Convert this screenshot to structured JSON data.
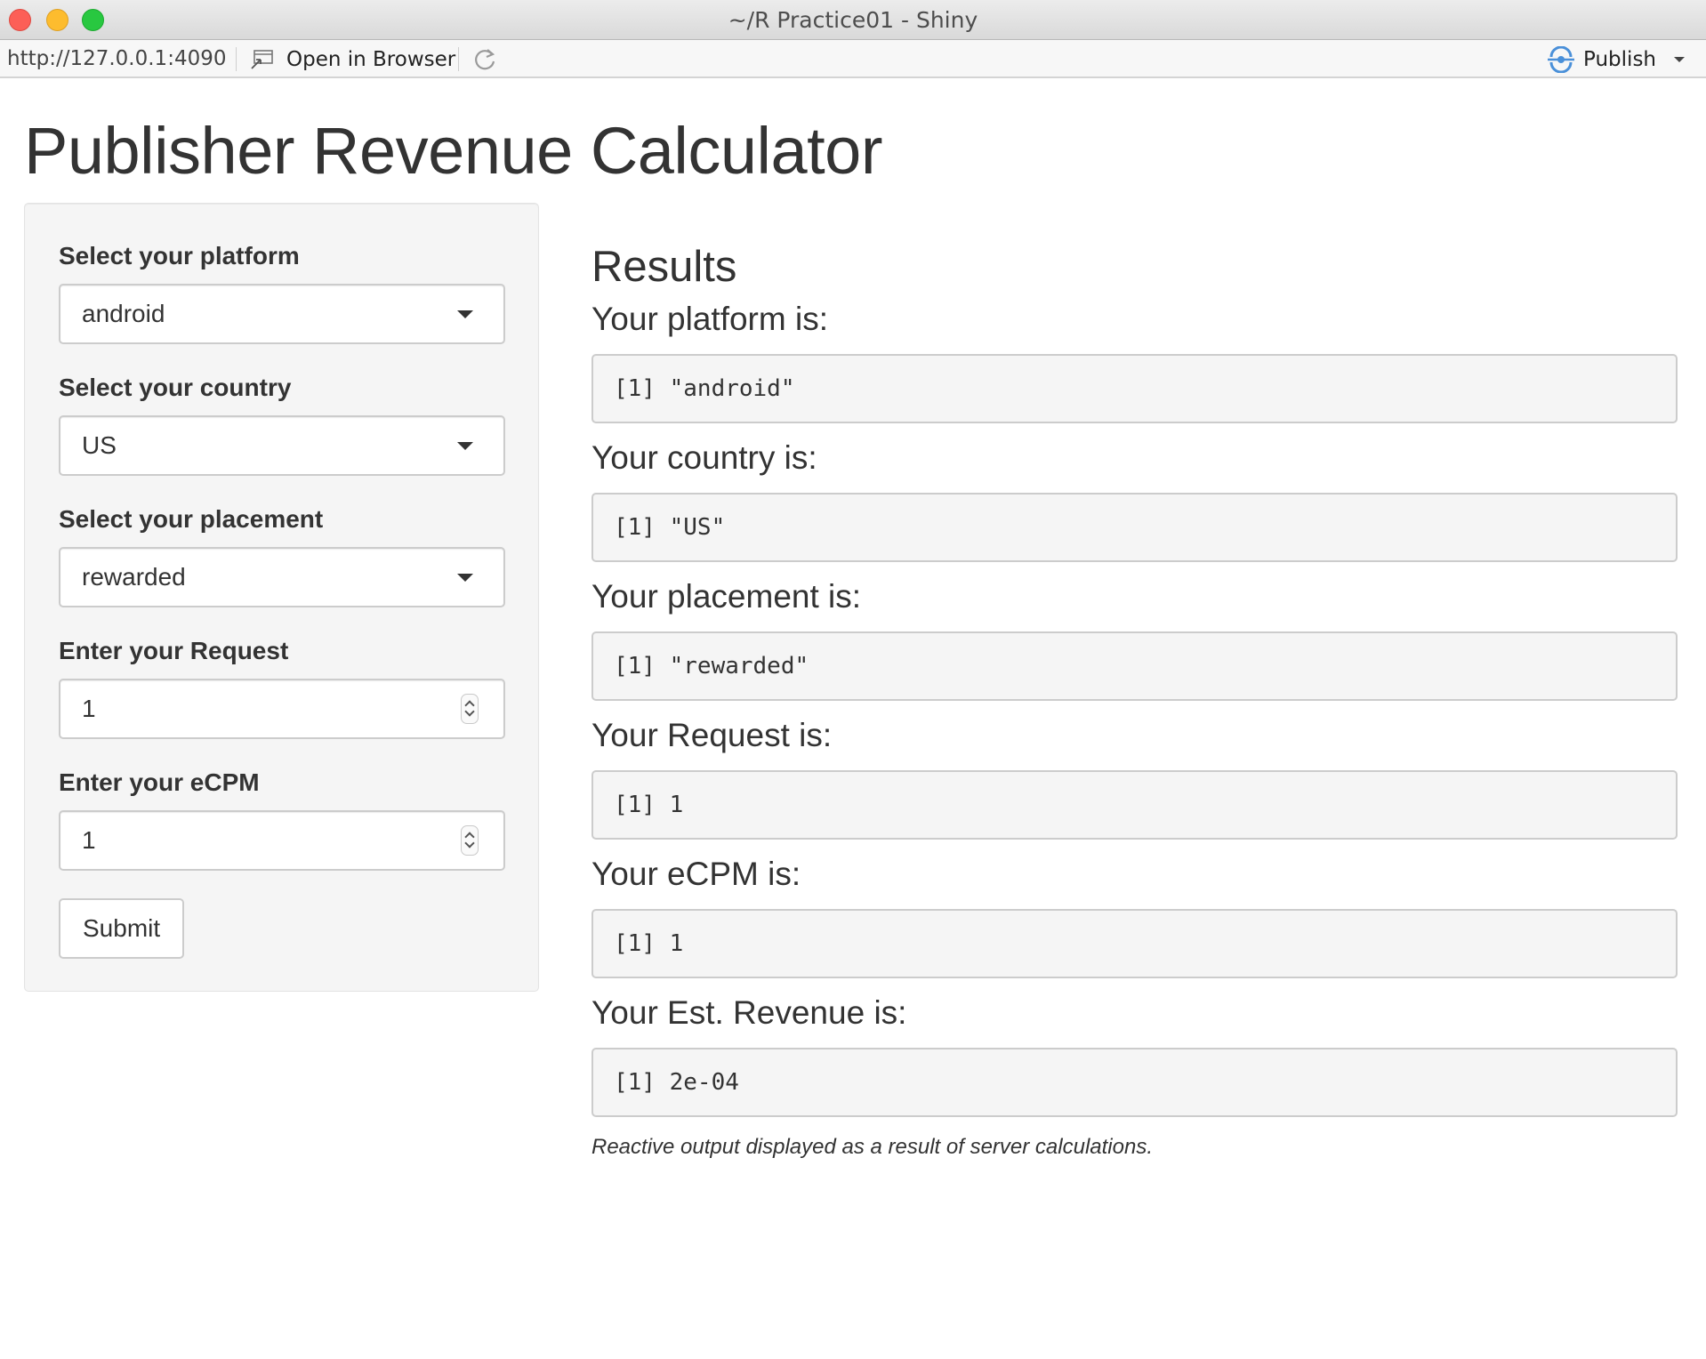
{
  "window": {
    "title": "~/R Practice01 - Shiny"
  },
  "toolbar": {
    "url": "http://127.0.0.1:4090",
    "open_in_browser": "Open in Browser",
    "publish": "Publish"
  },
  "app": {
    "title": "Publisher Revenue Calculator",
    "sidebar": {
      "platform_label": "Select your platform",
      "platform_value": "android",
      "country_label": "Select your country",
      "country_value": "US",
      "placement_label": "Select your placement",
      "placement_value": "rewarded",
      "request_label": "Enter your Request",
      "request_value": "1",
      "ecpm_label": "Enter your eCPM",
      "ecpm_value": "1",
      "submit_label": "Submit"
    },
    "results": {
      "title": "Results",
      "platform_label": "Your platform is:",
      "platform_output": "[1] \"android\"",
      "country_label": "Your country is:",
      "country_output": "[1] \"US\"",
      "placement_label": "Your placement is:",
      "placement_output": "[1] \"rewarded\"",
      "request_label": "Your Request is:",
      "request_output": "[1] 1",
      "ecpm_label": "Your eCPM is:",
      "ecpm_output": "[1] 1",
      "revenue_label": "Your Est. Revenue is:",
      "revenue_output": "[1] 2e-04",
      "note": "Reactive output displayed as a result of server calculations."
    }
  },
  "icons": {
    "close": "close-button-icon",
    "minimize": "minimize-button-icon",
    "zoom": "zoom-button-icon",
    "open_in_browser": "open-in-browser-icon",
    "refresh": "refresh-icon",
    "publish": "publish-icon"
  },
  "colors": {
    "close": "#fc5f57",
    "minimize": "#fdbc2e",
    "zoom": "#28c840",
    "publish_accent": "#4a90d9",
    "well_background": "#f5f5f5",
    "border": "#cccccc"
  }
}
